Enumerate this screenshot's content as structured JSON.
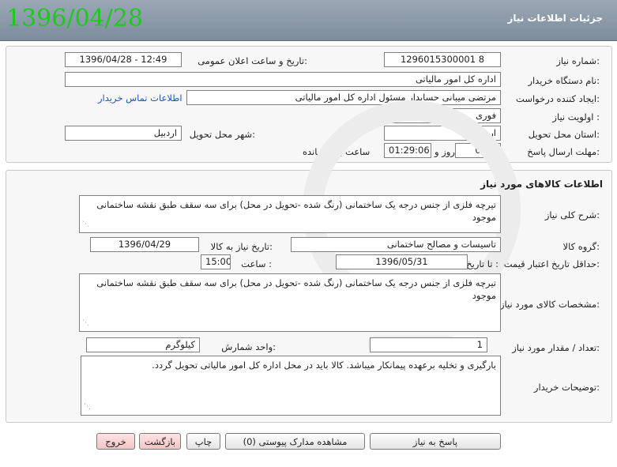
{
  "header": {
    "title": "جزئیات اطلاعات نیاز",
    "date": "1396/04/28"
  },
  "info": {
    "need_number_label": "شماره نیاز:",
    "need_number": "1296015300001 8",
    "announce_label": "تاریخ و ساعت اعلان عمومی:",
    "announce_value": "1396/04/28 - 12:49",
    "buyer_org_label": "نام دستگاه خریدار:",
    "buyer_org": "اداره کل امور مالیاتی",
    "requester_label": "ایجاد کننده درخواست:",
    "requester": "مرتضی میبانی حسابدار مسئول اداره کل امور مالیاتی",
    "contact_link": "اطلاعات تماس خریدار",
    "priority_label": "اولویت نیاز :",
    "priority": "فوری",
    "province_label": "استان محل تحویل:",
    "province": "اردبیل",
    "city_label": "شهر محل تحویل:",
    "city": "اردبیل",
    "deadline_label": "مهلت ارسال پاسخ:",
    "days": "0",
    "days_word": "روز و",
    "time_left": "01:29:06",
    "remaining_word": "ساعت باقی مانده"
  },
  "goods": {
    "section_title": "اطلاعات کالاهای مورد نیاز",
    "summary_label": "شرح کلی نیاز:",
    "summary": "تیرچه فلزی از جنس درجه یک ساختمانی (رنگ شده -تحویل در محل) برای سه سقف طبق نقشه ساختمانی موجود",
    "group_label": "گروه کالا:",
    "group": "تاسیسات و مصالح ساختمانی",
    "need_date_label": "تاریخ نیاز به کالا:",
    "need_date": "1396/04/29",
    "min_validity_label": "حداقل تاریخ اعتبار قیمت:",
    "until_date_label": "تا تاریخ :",
    "until_date": "1396/05/31",
    "time_label": "ساعت :",
    "time_value": "15:00",
    "specs_label": "مشخصات کالای مورد نیاز:",
    "specs": "تیرچه فلزی از جنس درجه یک ساختمانی (رنگ شده -تحویل در محل) برای سه سقف طبق نقشه ساختمانی موجود",
    "qty_label": "تعداد / مقدار مورد نیاز:",
    "qty": "1",
    "unit_label": "واحد شمارش:",
    "unit": "کیلوگرم",
    "buyer_notes_label": "توضیحات خریدار:",
    "buyer_notes": "بارگیری و تخلیه برعهده پیمانکار میباشد. کالا باید در محل اداره کل امور مالیاتی تحویل گردد."
  },
  "buttons": {
    "respond": "پاسخ به نیاز",
    "attachments": "مشاهده مدارک پیوستی (0)",
    "print": "چاپ",
    "back": "بازگشت",
    "exit": "خروج"
  },
  "colors": {
    "header_bg": "#8a98a8",
    "date_green": "#1ec81e",
    "link_blue": "#1a56b8",
    "pink_button": "#f3c4c4"
  }
}
